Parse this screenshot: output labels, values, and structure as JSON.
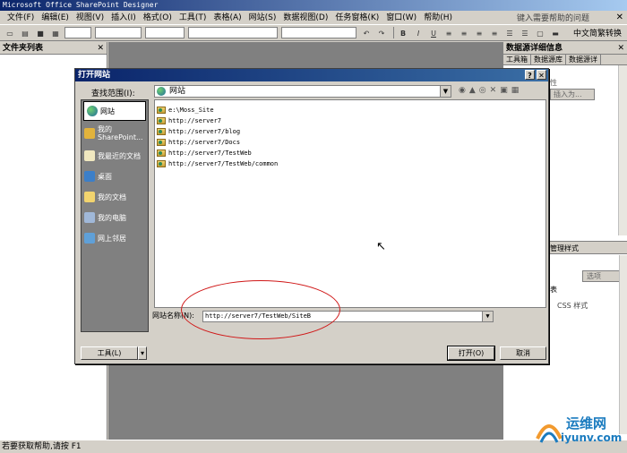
{
  "window": {
    "title": "Microsoft Office SharePoint Designer"
  },
  "menu": {
    "items": [
      "文件(F)",
      "编辑(E)",
      "视图(V)",
      "插入(I)",
      "格式(O)",
      "工具(T)",
      "表格(A)",
      "网站(S)",
      "数据视图(D)",
      "任务窗格(K)",
      "窗口(W)",
      "帮助(H)"
    ],
    "help_box": "键入需要帮助的问题"
  },
  "toolbar": {
    "ime_label": "中文简繁转换"
  },
  "left_pane": {
    "title": "文件夹列表"
  },
  "right_pane": {
    "title": "数据源详细信息",
    "tabs": [
      "工具箱",
      "数据源库",
      "数据源详"
    ],
    "upper_text": "性",
    "insert_button": "插入为...",
    "lower_title": "管理样式",
    "lower_options": "选项",
    "lower_text": "表",
    "lower_css": "CSS 样式"
  },
  "dialog": {
    "title": "打开网站",
    "look_in_label": "查找范围(I):",
    "look_in_value": "网站",
    "places": [
      {
        "label": "网站",
        "icon": "globe-icon"
      },
      {
        "label": "我的 SharePoint...",
        "icon": "sharepoint-icon"
      },
      {
        "label": "我最近的文档",
        "icon": "recent-docs-icon"
      },
      {
        "label": "桌面",
        "icon": "desktop-icon"
      },
      {
        "label": "我的文档",
        "icon": "my-documents-icon"
      },
      {
        "label": "我的电脑",
        "icon": "my-computer-icon"
      },
      {
        "label": "网上邻居",
        "icon": "network-icon"
      }
    ],
    "files": [
      "e:\\Moss_Site",
      "http://server7",
      "http://server7/blog",
      "http://server7/Docs",
      "http://server7/TestWeb",
      "http://server7/TestWeb/common"
    ],
    "site_name_label": "网站名称(N):",
    "site_name_value": "http://server7/TestWeb/SiteB",
    "tools_button": "工具(L)",
    "open_button": "打开(O)",
    "cancel_button": "取消"
  },
  "status": {
    "text": "若要获取帮助,请按 F1"
  },
  "watermark": {
    "name": "运维网",
    "url": "iyunv.com"
  }
}
